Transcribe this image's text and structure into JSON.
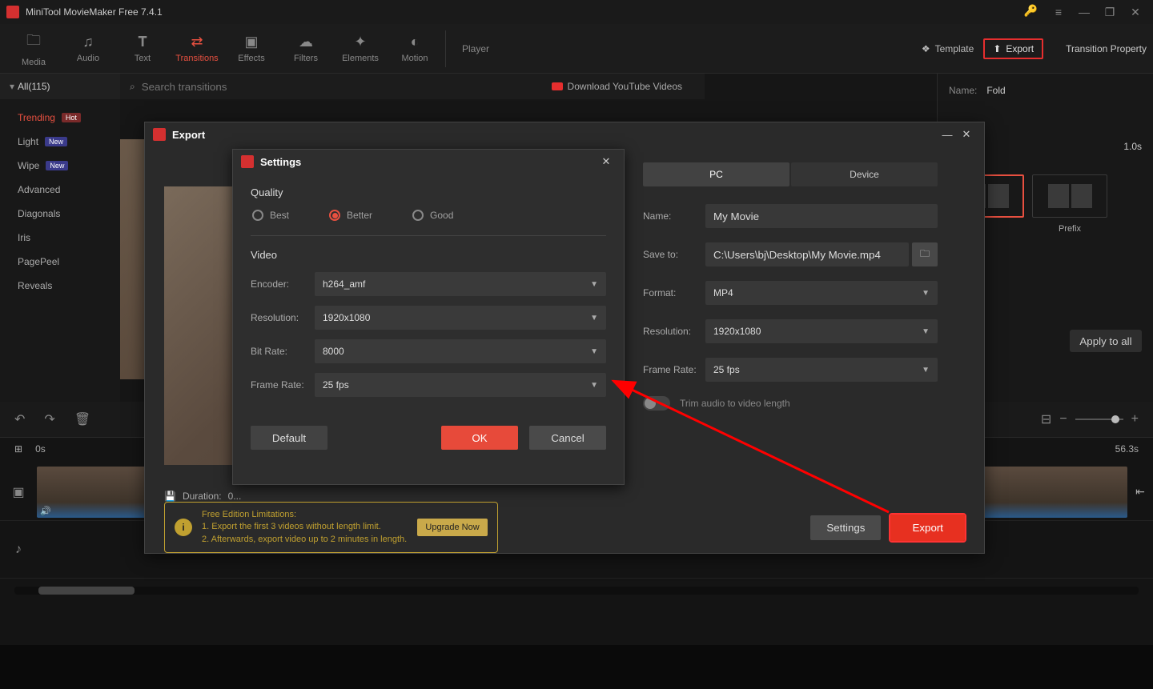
{
  "titlebar": {
    "title": "MiniTool MovieMaker Free 7.4.1"
  },
  "toolbar": {
    "tabs": [
      {
        "label": "Media"
      },
      {
        "label": "Audio"
      },
      {
        "label": "Text"
      },
      {
        "label": "Transitions"
      },
      {
        "label": "Effects"
      },
      {
        "label": "Filters"
      },
      {
        "label": "Elements"
      },
      {
        "label": "Motion"
      }
    ],
    "player": "Player",
    "template": "Template",
    "export": "Export",
    "property": "Transition Property"
  },
  "sidebar": {
    "all": "All(115)",
    "search_placeholder": "Search transitions",
    "download_yt": "Download YouTube Videos",
    "items": [
      {
        "label": "Trending",
        "badge": "Hot"
      },
      {
        "label": "Light",
        "badge": "New"
      },
      {
        "label": "Wipe",
        "badge": "New"
      },
      {
        "label": "Advanced"
      },
      {
        "label": "Diagonals"
      },
      {
        "label": "Iris"
      },
      {
        "label": "PagePeel"
      },
      {
        "label": "Reveals"
      }
    ]
  },
  "props": {
    "name_label": "Name:",
    "name_value": "Fold",
    "duration_value": "1.0s",
    "mode_prefix": "Prefix",
    "apply": "Apply to all"
  },
  "timeline": {
    "start": "0s",
    "end": "56.3s"
  },
  "export_dlg": {
    "title": "Export",
    "duration_label": "Duration:",
    "duration_trunc": "0...",
    "tabs": {
      "pc": "PC",
      "device": "Device"
    },
    "form": {
      "name_label": "Name:",
      "name_value": "My Movie",
      "save_label": "Save to:",
      "save_value": "C:\\Users\\bj\\Desktop\\My Movie.mp4",
      "format_label": "Format:",
      "format_value": "MP4",
      "resolution_label": "Resolution:",
      "resolution_value": "1920x1080",
      "fps_label": "Frame Rate:",
      "fps_value": "25 fps",
      "trim_label": "Trim audio to video length"
    },
    "free": {
      "title": "Free Edition Limitations:",
      "line1": "1. Export the first 3 videos without length limit.",
      "line2": "2. Afterwards, export video up to 2 minutes in length.",
      "upgrade": "Upgrade Now"
    },
    "settings_btn": "Settings",
    "export_btn": "Export"
  },
  "settings_dlg": {
    "title": "Settings",
    "quality_section": "Quality",
    "quality": {
      "best": "Best",
      "better": "Better",
      "good": "Good"
    },
    "video_section": "Video",
    "encoder_label": "Encoder:",
    "encoder_value": "h264_amf",
    "resolution_label": "Resolution:",
    "resolution_value": "1920x1080",
    "bitrate_label": "Bit Rate:",
    "bitrate_value": "8000",
    "fps_label": "Frame Rate:",
    "fps_value": "25 fps",
    "default_btn": "Default",
    "ok_btn": "OK",
    "cancel_btn": "Cancel"
  }
}
